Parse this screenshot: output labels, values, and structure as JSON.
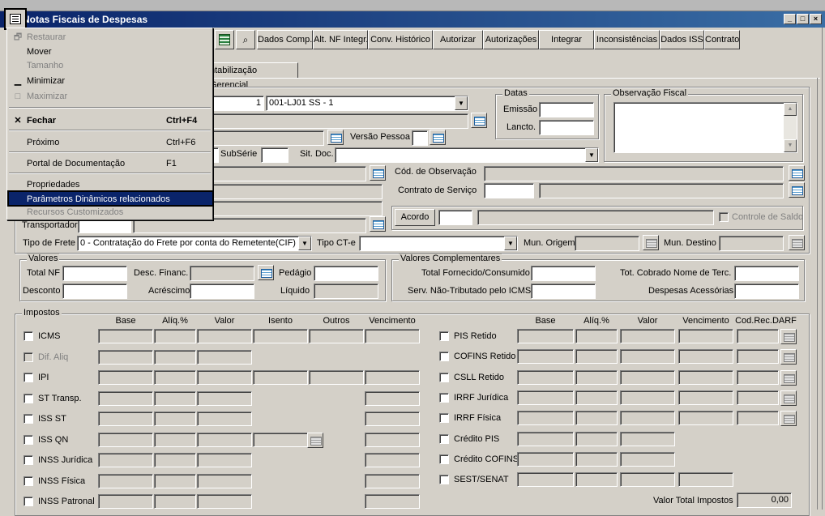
{
  "window": {
    "title": "Notas Fiscais de Despesas",
    "controls": [
      "_",
      "□",
      "×"
    ]
  },
  "toolbar": {
    "buttons": [
      "Dados Comp.",
      "Alt. NF Integr.",
      "Conv. Histórico",
      "Autorizar",
      "Autorizações",
      "Integrar",
      "Inconsistências",
      "Dados ISS",
      "Contrato"
    ]
  },
  "tabs": {
    "contab_gerencial": "ntabilização Gerencial",
    "contab_gerencial_underline": "G"
  },
  "system_menu": {
    "items": [
      {
        "label": "Restaurar",
        "shortcut": "",
        "icon": "restore-icon",
        "disabled": true
      },
      {
        "label": "Mover",
        "shortcut": "",
        "icon": "",
        "disabled": false
      },
      {
        "label": "Tamanho",
        "shortcut": "",
        "icon": "",
        "disabled": true
      },
      {
        "label": "Minimizar",
        "shortcut": "",
        "icon": "minimize-icon",
        "disabled": false
      },
      {
        "label": "Maximizar",
        "shortcut": "",
        "icon": "maximize-icon",
        "disabled": true
      },
      {
        "label": "Fechar",
        "shortcut": "Ctrl+F4",
        "icon": "close-icon",
        "disabled": false
      },
      {
        "label": "Próximo",
        "shortcut": "Ctrl+F6",
        "icon": "",
        "disabled": false
      },
      {
        "label": "Portal de Documentação",
        "shortcut": "F1",
        "icon": "",
        "disabled": false
      },
      {
        "label": "Propriedades",
        "shortcut": "",
        "icon": "",
        "disabled": false
      },
      {
        "label": "Parâmetros Dinâmicos relacionados",
        "shortcut": "",
        "icon": "",
        "disabled": false
      },
      {
        "label": "Recursos Customizados",
        "shortcut": "",
        "icon": "",
        "disabled": true
      }
    ]
  },
  "header": {
    "serie_num": "1",
    "estab_value": "001-LJ01 SS - 1",
    "versao_pessoa_label": "Versão Pessoa",
    "subserie_label": "SubSérie",
    "sit_doc_label": "Sit. Doc.",
    "cod_obs_label": "Cód. de Observação",
    "contrato_servico_label": "Contrato de Serviço",
    "transportador_label": "Transportador",
    "acordo_button": "Acordo",
    "controle_saldo_label": "Controle de Saldo",
    "tipo_frete_label": "Tipo de Frete",
    "tipo_frete_value": "0 - Contratação do Frete por conta do Remetente(CIF)",
    "tipo_cte_label": "Tipo CT-e",
    "mun_origem_label": "Mun. Origem",
    "mun_destino_label": "Mun. Destino"
  },
  "datas": {
    "title": "Datas",
    "emissao_label": "Emissão",
    "lancto_label": "Lancto."
  },
  "observacao": {
    "title": "Observação Fiscal"
  },
  "valores": {
    "title": "Valores",
    "total_nf": "Total NF",
    "desc_financ": "Desc. Financ.",
    "pedagio": "Pedágio",
    "desconto": "Desconto",
    "acrescimo": "Acréscimo",
    "liquido": "Líquido"
  },
  "valores_complementares": {
    "title": "Valores Complementares",
    "total_fornecido": "Total Fornecido/Consumido",
    "tot_cobrado": "Tot. Cobrado Nome de Terc.",
    "serv_nao_trib": "Serv. Não-Tributado pelo ICMS",
    "despesas_acessorias": "Despesas Acessórias"
  },
  "impostos": {
    "title": "Impostos",
    "left_headers": [
      "Base",
      "Alíq.%",
      "Valor",
      "Isento",
      "Outros",
      "Vencimento"
    ],
    "right_headers": [
      "Base",
      "Alíq.%",
      "Valor",
      "Vencimento",
      "Cod.Rec.DARF"
    ],
    "left_rows": [
      {
        "label": "ICMS",
        "disabled": false
      },
      {
        "label": "Dif. Aliq",
        "disabled": true
      },
      {
        "label": "IPI",
        "disabled": false
      },
      {
        "label": "ST Transp.",
        "disabled": false
      },
      {
        "label": "ISS ST",
        "disabled": false
      },
      {
        "label": "ISS QN",
        "disabled": false
      },
      {
        "label": "INSS Jurídica",
        "disabled": false
      },
      {
        "label": "INSS Física",
        "disabled": false
      },
      {
        "label": "INSS Patronal",
        "disabled": false
      }
    ],
    "right_rows": [
      {
        "label": "PIS Retido"
      },
      {
        "label": "COFINS Retido"
      },
      {
        "label": "CSLL Retido"
      },
      {
        "label": "IRRF Jurídica"
      },
      {
        "label": "IRRF Física"
      },
      {
        "label": "Crédito PIS"
      },
      {
        "label": "Crédito COFINS"
      },
      {
        "label": "SEST/SENAT"
      }
    ],
    "valor_total_label": "Valor Total Impostos",
    "valor_total": "0,00"
  }
}
